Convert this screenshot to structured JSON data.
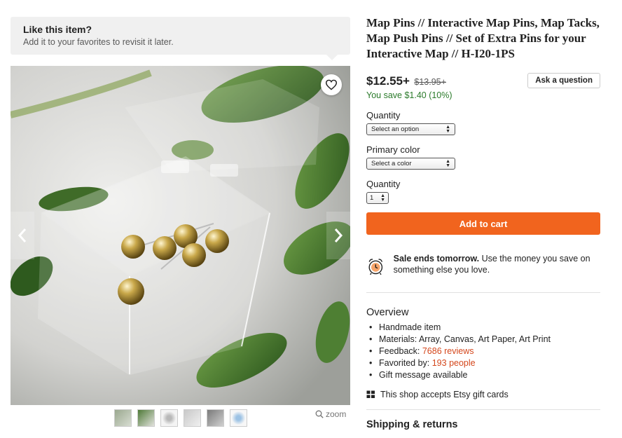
{
  "favorites_banner": {
    "title": "Like this item?",
    "subtitle": "Add it to your favorites to revisit it later."
  },
  "gallery": {
    "thumbnail_count": 6,
    "zoom_label": "zoom",
    "icons": {
      "favorite": "heart-icon",
      "prev": "chevron-left-icon",
      "next": "chevron-right-icon",
      "zoom": "magnifier-icon"
    }
  },
  "listing": {
    "title": "Map Pins // Interactive Map Pins, Map Tacks, Map Push Pins // Set of Extra Pins for your Interactive Map // H-I20-1PS",
    "price": "$12.55+",
    "original_price": "$13.95+",
    "savings": "You save $1.40 (10%)",
    "ask_question_label": "Ask a question"
  },
  "options": {
    "quantity_label": "Quantity",
    "quantity_select": "Select an option",
    "color_label": "Primary color",
    "color_select": "Select a color",
    "qty_label": "Quantity",
    "qty_value": "1"
  },
  "cart": {
    "add_label": "Add to cart",
    "color": "#f1641e"
  },
  "sale": {
    "headline": "Sale ends tomorrow.",
    "body": " Use the money you save on something else you love."
  },
  "overview": {
    "title": "Overview",
    "handmade": "Handmade item",
    "materials": "Materials: Array, Canvas, Art Paper, Art Print",
    "feedback_label": "Feedback: ",
    "feedback_link": "7686 reviews",
    "favorited_label": "Favorited by: ",
    "favorited_link": "193 people",
    "gift_message": "Gift message available"
  },
  "gift_cards": "This shop accepts Etsy gift cards",
  "shipping_heading": "Shipping & returns"
}
